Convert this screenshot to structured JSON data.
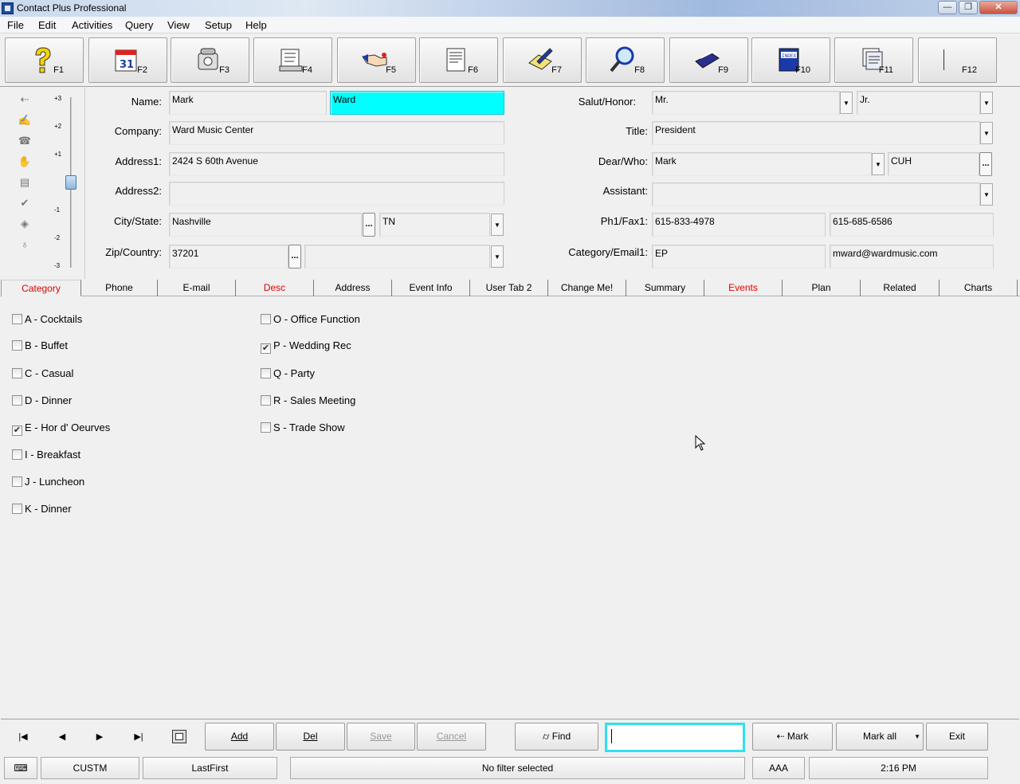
{
  "window": {
    "title": "Contact Plus Professional",
    "minimize": "—",
    "restore": "❐",
    "close": "✕"
  },
  "menu": [
    "File",
    "Edit",
    "Activities",
    "Query",
    "View",
    "Setup",
    "Help"
  ],
  "toolbar": [
    "F1",
    "F2",
    "F3",
    "F4",
    "F5",
    "F6",
    "F7",
    "F8",
    "F9",
    "F10",
    "F11",
    "F12"
  ],
  "slider": {
    "ticks": [
      "+3",
      "+2",
      "+1",
      "-1",
      "-2",
      "-3"
    ],
    "level": 0.5
  },
  "form": {
    "name_label": "Name:",
    "first_name": "Mark",
    "last_name": "Ward",
    "company_label": "Company:",
    "company": "Ward Music Center",
    "address1_label": "Address1:",
    "address1": "2424 S 60th Avenue",
    "address2_label": "Address2:",
    "address2": "",
    "citystate_label": "City/State:",
    "city": "Nashville",
    "state": "TN",
    "zipcountry_label": "Zip/Country:",
    "zip": "37201",
    "country": "",
    "salut_label": "Salut/Honor:",
    "salutation": "Mr.",
    "honor": "Jr.",
    "title_label": "Title:",
    "title": "President",
    "dearwho_label": "Dear/Who:",
    "dear": "Mark",
    "who": "CUH",
    "assistant_label": "Assistant:",
    "assistant": "",
    "phfax_label": "Ph1/Fax1:",
    "phone1": "615-833-4978",
    "fax1": "615-685-6586",
    "catemail_label": "Category/Email1:",
    "category": "EP",
    "email1": "mward@wardmusic.com",
    "ellipsis": "...",
    "dropdown": "▼"
  },
  "tabs": [
    {
      "label": "Category",
      "red": true
    },
    {
      "label": "Phone",
      "red": false
    },
    {
      "label": "E-mail",
      "red": false
    },
    {
      "label": "Desc",
      "red": true
    },
    {
      "label": "Address",
      "red": false
    },
    {
      "label": "Event Info",
      "red": false
    },
    {
      "label": "User Tab 2",
      "red": false
    },
    {
      "label": "Change Me!",
      "red": false
    },
    {
      "label": "Summary",
      "red": false
    },
    {
      "label": "Events",
      "red": true
    },
    {
      "label": "Plan",
      "red": false
    },
    {
      "label": "Related",
      "red": false
    },
    {
      "label": "Charts",
      "red": false
    }
  ],
  "categories_left": [
    {
      "label": "A - Cocktails",
      "checked": false
    },
    {
      "label": "B - Buffet",
      "checked": false
    },
    {
      "label": "C - Casual",
      "checked": false
    },
    {
      "label": "D - Dinner",
      "checked": false
    },
    {
      "label": "E - Hor d' Oeurves",
      "checked": true
    },
    {
      "label": "I - Breakfast",
      "checked": false
    },
    {
      "label": "J - Luncheon",
      "checked": false
    },
    {
      "label": "K - Dinner",
      "checked": false
    }
  ],
  "categories_right": [
    {
      "label": "O - Office Function",
      "checked": false
    },
    {
      "label": "P - Wedding Rec",
      "checked": true
    },
    {
      "label": "Q - Party",
      "checked": false
    },
    {
      "label": "R - Sales Meeting",
      "checked": false
    },
    {
      "label": "S - Trade Show",
      "checked": false
    }
  ],
  "nav": {
    "first": "|◀",
    "prev": "◀",
    "next": "▶",
    "last": "▶|"
  },
  "actions": {
    "add": "Add",
    "del": "Del",
    "save": "Save",
    "cancel": "Cancel",
    "find": "Find",
    "find_value": "",
    "mark": "Mark",
    "mark_all": "Mark all",
    "exit": "Exit"
  },
  "status": {
    "mode": "CUSTM",
    "sort": "LastFirst",
    "filter": "No filter selected",
    "code": "AAA",
    "time": "2:16 PM"
  }
}
